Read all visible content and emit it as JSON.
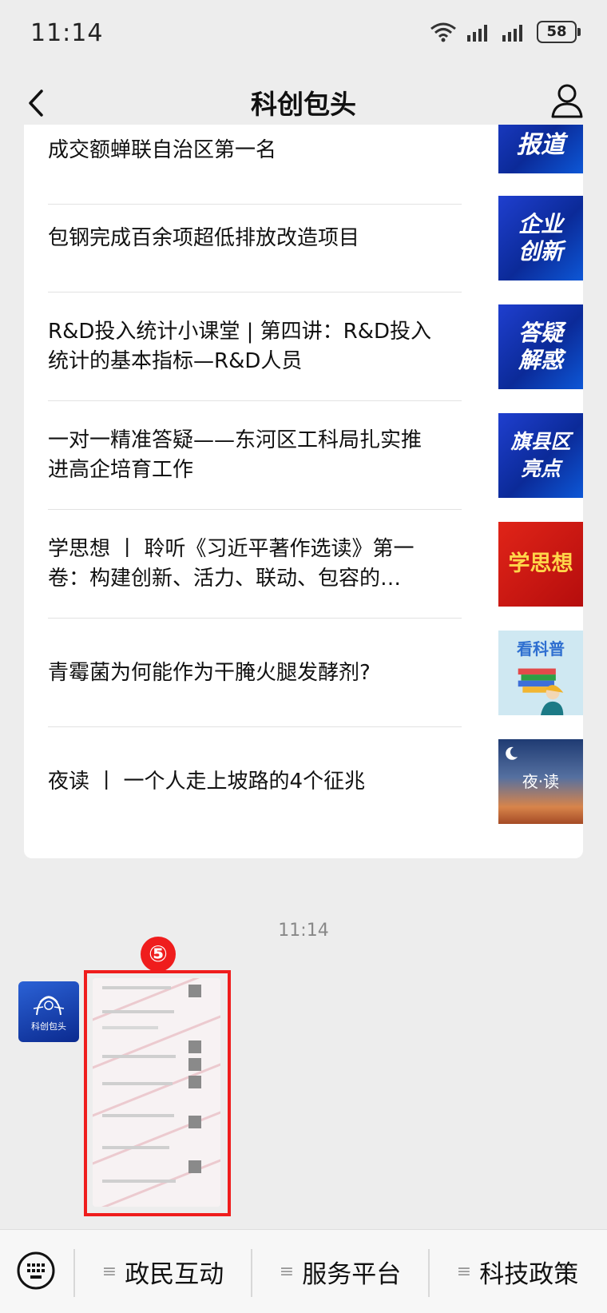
{
  "status_bar": {
    "time": "11:14",
    "battery": "58"
  },
  "header": {
    "title": "科创包头"
  },
  "articles": [
    {
      "lines": [
        "成交额蝉联自治区第一名"
      ],
      "thumb_text": "报道"
    },
    {
      "lines": [
        "包钢完成百余项超低排放改造项目"
      ],
      "thumb_text": "企业创新"
    },
    {
      "lines": [
        "R&D投入统计小课堂 | 第四讲：R&D投入",
        "统计的基本指标—R&D人员"
      ],
      "thumb_text": "答疑解惑"
    },
    {
      "lines": [
        "一对一精准答疑——东河区工科局扎实推",
        "进高企培育工作"
      ],
      "thumb_text": "旗县区亮点"
    },
    {
      "lines": [
        "学思想 丨 聆听《习近平著作选读》第一",
        "卷：构建创新、活力、联动、包容的…"
      ],
      "thumb_text": "学思想"
    },
    {
      "lines": [
        "青霉菌为何能作为干腌火腿发酵剂?"
      ],
      "thumb_text": "看科普"
    },
    {
      "lines": [
        "夜读 丨 一个人走上坡路的4个征兆"
      ],
      "thumb_text": "夜·读"
    }
  ],
  "chat": {
    "timestamp": "11:14",
    "annotation_number": "⑤",
    "avatar_text": "科创包头"
  },
  "bottom_menu": {
    "item1": "政民互动",
    "item2": "服务平台",
    "item3": "科技政策"
  },
  "colors": {
    "annotation": "#ef1d1d",
    "thumb_blue": "#1538c4"
  }
}
